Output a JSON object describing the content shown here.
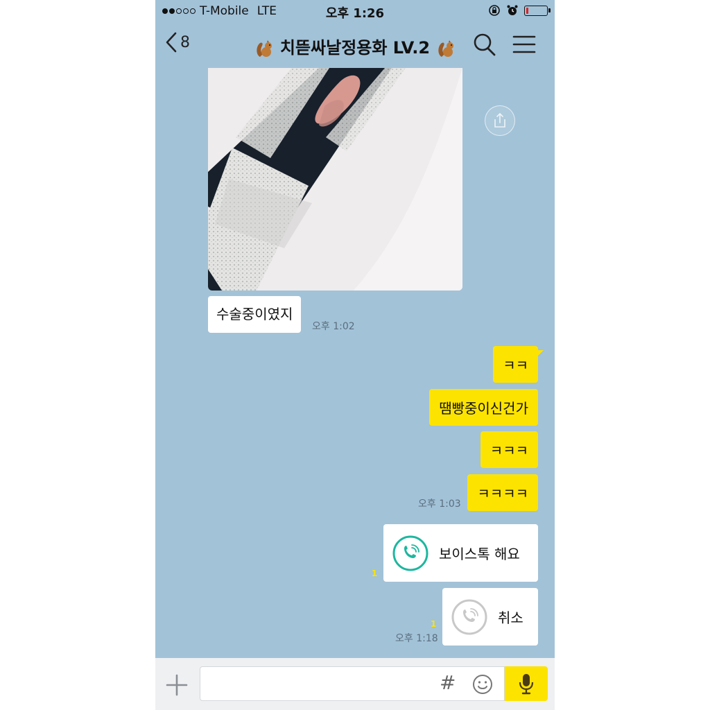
{
  "status_bar": {
    "carrier": "T-Mobile",
    "network": "LTE",
    "time": "오후 1:26",
    "signal_bars": 2
  },
  "header": {
    "back_count": "8",
    "title": "치뜯싸날정용화 LV.2"
  },
  "messages": {
    "in_text": "수술중이였지",
    "in_time": "오후 1:02",
    "out_1": "ㅋㅋ",
    "out_2": "땜빵중이신건가",
    "out_3": "ㅋㅋㅋ",
    "out_4": "ㅋㅋㅋㅋ",
    "out_time": "오후 1:03",
    "voice_label": "보이스톡 해요",
    "voice_unread": "1",
    "cancel_label": "취소",
    "cancel_unread": "1",
    "cancel_time": "오후 1:18"
  },
  "input": {
    "hash": "#",
    "placeholder": ""
  },
  "colors": {
    "chat_bg": "#a2c2d8",
    "my_bubble": "#fde300",
    "call_teal": "#1cb79f"
  }
}
